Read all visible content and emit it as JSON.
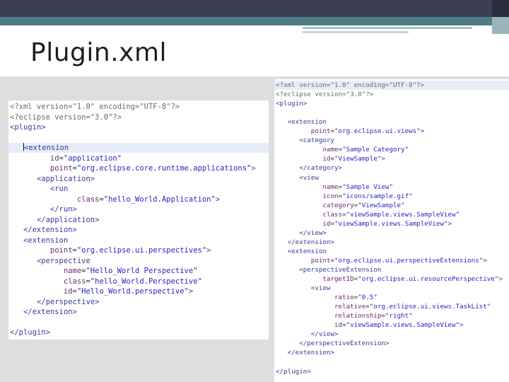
{
  "slide": {
    "title": "Plugin.xml"
  },
  "colors": {
    "top_bar": "#3c3e52",
    "accent_band": "#4d7e88",
    "content_bg": "#dedede",
    "xml_tag": "#3a3a9a",
    "xml_attr": "#6c2a6c",
    "xml_value": "#2a1fc4"
  },
  "left_code": {
    "lines": [
      "<?xml version=\"1.0\" encoding=\"UTF-8\"?>",
      "<?eclipse version=\"3.0\"?>",
      "<plugin>",
      "",
      "   <extension",
      "         id=\"application\"",
      "         point=\"org.eclipse.core.runtime.applications\">",
      "      <application>",
      "         <run",
      "               class=\"hello_World.Application\">",
      "         </run>",
      "      </application>",
      "   </extension>",
      "   <extension",
      "         point=\"org.eclipse.ui.perspectives\">",
      "      <perspective",
      "            name=\"Hello_World Perspective\"",
      "            class=\"hello_World.Perspective\"",
      "            id=\"Hello_World.perspective\">",
      "      </perspective>",
      "   </extension>",
      "",
      "</plugin>"
    ]
  },
  "right_code": {
    "lines": [
      "<?xml version=\"1.0\" encoding=\"UTF-8\"?>",
      "<?eclipse version=\"3.0\"?>",
      "<plugin>",
      "",
      "   <extension",
      "         point=\"org.eclipse.ui.views\">",
      "      <category",
      "            name=\"Sample Category\"",
      "            id=\"ViewSample\">",
      "      </category>",
      "      <view",
      "            name=\"Sample View\"",
      "            icon=\"icons/sample.gif\"",
      "            category=\"ViewSample\"",
      "            class=\"viewSample.views.SampleView\"",
      "            id=\"viewSample.views.SampleView\">",
      "      </view>",
      "   </extension>",
      "   <extension",
      "         point=\"org.eclipse.ui.perspectiveExtensions\">",
      "      <perspectiveExtension",
      "            targetID=\"org.eclipse.ui.resourcePerspective\">",
      "         <view",
      "               ratio=\"0.5\"",
      "               relative=\"org.eclipse.ui.views.TaskList\"",
      "               relationship=\"right\"",
      "               id=\"viewSample.views.SampleView\">",
      "         </view>",
      "      </perspectiveExtension>",
      "   </extension>",
      "",
      "</plugin>"
    ]
  }
}
